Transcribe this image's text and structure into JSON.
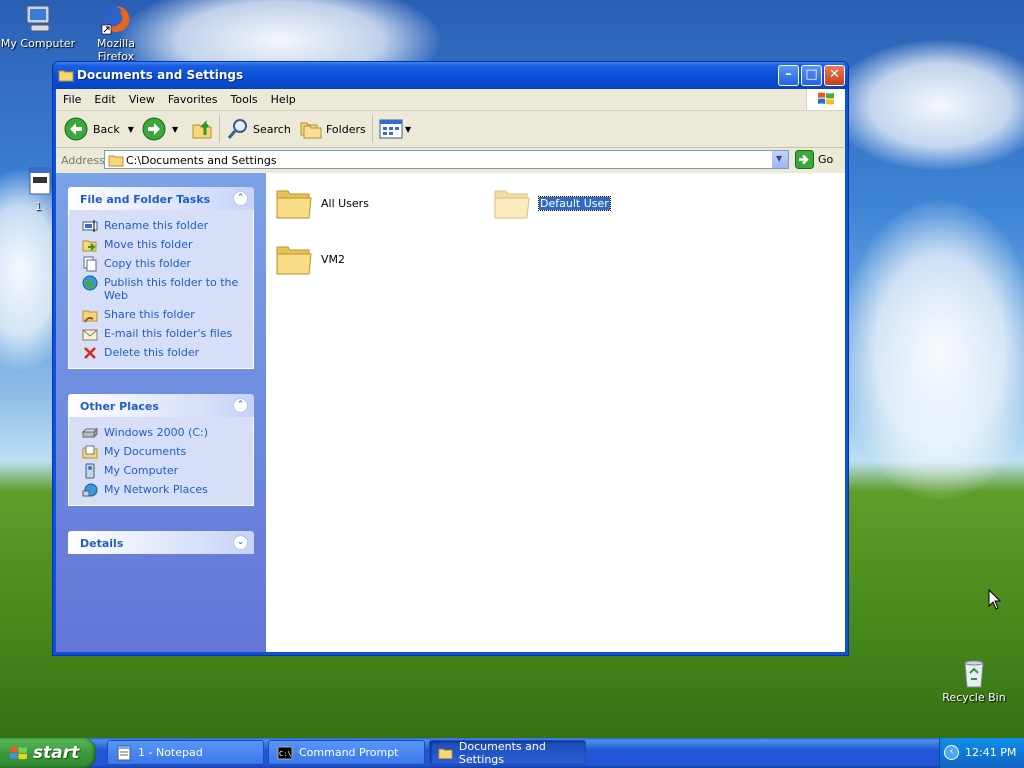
{
  "desktop": {
    "icons": [
      {
        "label": "My Computer"
      },
      {
        "label": "Mozilla Firefox"
      },
      {
        "label": "1"
      },
      {
        "label": "Recycle Bin"
      }
    ]
  },
  "window": {
    "title": "Documents and Settings",
    "menu": [
      "File",
      "Edit",
      "View",
      "Favorites",
      "Tools",
      "Help"
    ],
    "toolbar": {
      "back_label": "Back",
      "search_label": "Search",
      "folders_label": "Folders"
    },
    "address": {
      "label": "Address",
      "value": "C:\\Documents and Settings",
      "go_label": "Go"
    },
    "file_tasks": {
      "title": "File and Folder Tasks",
      "items": [
        {
          "label": "Rename this folder",
          "icon": "rename-icon"
        },
        {
          "label": "Move this folder",
          "icon": "move-icon"
        },
        {
          "label": "Copy this folder",
          "icon": "copy-icon"
        },
        {
          "label": "Publish this folder to the Web",
          "icon": "publish-icon"
        },
        {
          "label": "Share this folder",
          "icon": "share-icon"
        },
        {
          "label": "E-mail this folder's files",
          "icon": "email-icon"
        },
        {
          "label": "Delete this folder",
          "icon": "delete-icon"
        }
      ]
    },
    "other_places": {
      "title": "Other Places",
      "items": [
        {
          "label": "Windows 2000 (C:)",
          "icon": "drive-icon"
        },
        {
          "label": "My Documents",
          "icon": "my-documents-icon"
        },
        {
          "label": "My Computer",
          "icon": "my-computer-icon"
        },
        {
          "label": "My Network Places",
          "icon": "network-places-icon"
        }
      ]
    },
    "details": {
      "title": "Details"
    },
    "folders": [
      {
        "name": "All Users",
        "selected": false
      },
      {
        "name": "Default User",
        "selected": true
      },
      {
        "name": "VM2",
        "selected": false
      }
    ]
  },
  "taskbar": {
    "start_label": "start",
    "tasks": [
      {
        "label": "1 - Notepad",
        "active": false
      },
      {
        "label": "Command Prompt",
        "active": false
      },
      {
        "label": "Documents and Settings",
        "active": true
      }
    ],
    "clock": "12:41 PM"
  },
  "colors": {
    "link_blue": "#215dc6",
    "selection_blue": "#316ac5",
    "titlebar_blue": "#0a4fd8",
    "start_green": "#3c9a3c"
  }
}
